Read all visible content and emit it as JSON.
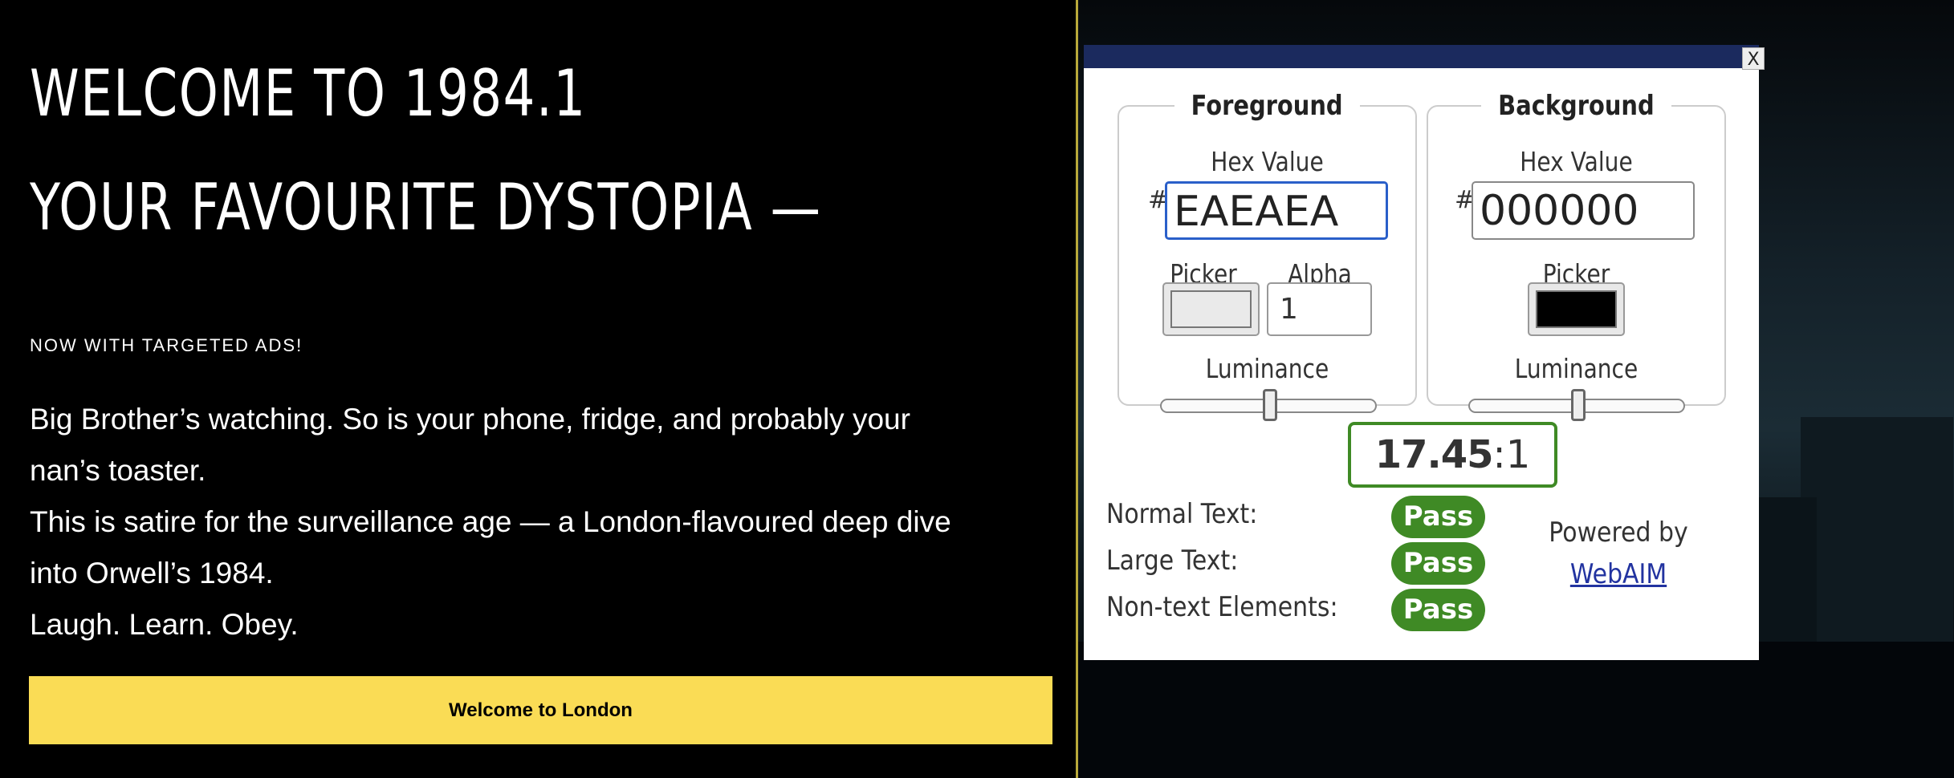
{
  "hero": {
    "heading_line1": "WELCOME TO 1984.1",
    "heading_line2": "YOUR FAVOURITE DYSTOPIA —",
    "tagline": "NOW WITH TARGETED ADS!",
    "paragraph_lines": [
      "Big Brother’s watching. So is your phone, fridge, and probably your",
      "nan’s toaster.",
      "This is satire for the surveillance age — a London-flavoured deep dive",
      "into Orwell’s 1984.",
      "Laugh. Learn. Obey."
    ],
    "cta_label": "Welcome to London",
    "cta_color": "#FADC55"
  },
  "contrast_checker": {
    "close_label": "X",
    "foreground": {
      "legend": "Foreground",
      "hex_label": "Hex Value",
      "hash": "#",
      "hex_value": "EAEAEA",
      "picker_label": "Picker",
      "alpha_label": "Alpha",
      "alpha_value": "1",
      "luminance_label": "Luminance",
      "luminance_level": 0.5,
      "color": "#EAEAEA"
    },
    "background": {
      "legend": "Background",
      "hex_label": "Hex Value",
      "hash": "#",
      "hex_value": "000000",
      "picker_label": "Picker",
      "luminance_label": "Luminance",
      "luminance_level": 0.5,
      "color": "#000000"
    },
    "ratio_main": "17.45",
    "ratio_suffix": ":1",
    "results": [
      {
        "label": "Normal Text:",
        "status": "Pass"
      },
      {
        "label": "Large Text:",
        "status": "Pass"
      },
      {
        "label": "Non-text Elements:",
        "status": "Pass"
      }
    ],
    "powered_by": "Powered by",
    "link": "WebAIM",
    "pass_color": "#3F8A25"
  }
}
